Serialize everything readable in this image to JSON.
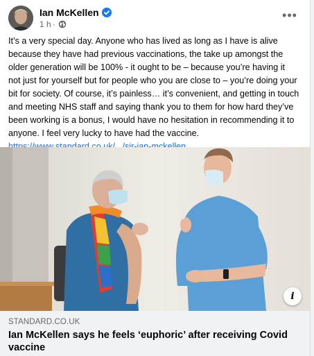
{
  "post": {
    "author": "Ian McKellen",
    "time": "1 h",
    "separator": "·",
    "more_label": "•••",
    "verified_color": "#1877f2",
    "text": "It’s a very special day. Anyone who has lived as long as I have is alive because they have had previous vaccinations, the take up amongst the older generation will be 100% - it ought to be – because you’re having it not just for yourself but for people who you are close to – you’re doing your bit for society. Of course, it’s painless… it’s convenient, and getting in touch and meeting NHS staff and saying thank you to them for how hard they’ve been working is a bonus, I would have no hesitation in recommending it to anyone. I feel very lucky to have had the vaccine.",
    "link_text": "https://www.standard.co.uk/.../sir-ian-mckellen..."
  },
  "media": {
    "info_label": "i"
  },
  "link_card": {
    "domain": "STANDARD.CO.UK",
    "headline": "Ian McKellen says he feels ‘euphoric’ after receiving Covid vaccine"
  },
  "icons": {
    "verified": "verified-badge-icon",
    "globe": "globe-icon",
    "more": "more-options-icon",
    "info": "info-icon"
  }
}
